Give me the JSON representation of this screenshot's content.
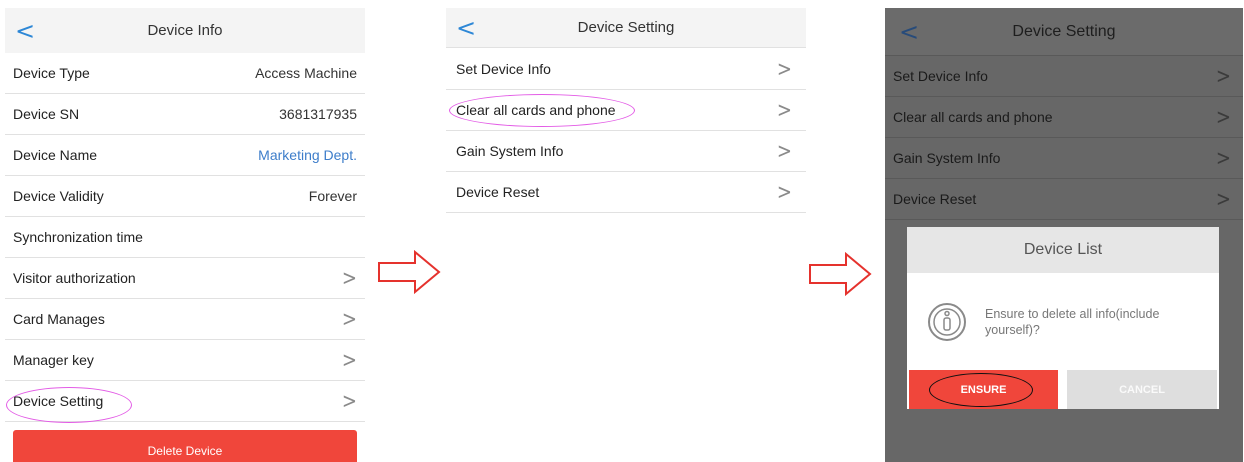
{
  "panel_device_info": {
    "title": "Device Info",
    "back_glyph": "<",
    "rows": [
      {
        "label": "Device Type",
        "value": "Access Machine"
      },
      {
        "label": "Device SN",
        "value": "3681317935"
      },
      {
        "label": "Device Name",
        "value": "Marketing Dept."
      },
      {
        "label": "Device Validity",
        "value": "Forever"
      },
      {
        "label": "Synchronization time",
        "value": ""
      },
      {
        "label": "Visitor authorization",
        "value": ">"
      },
      {
        "label": "Card Manages",
        "value": ">"
      },
      {
        "label": "Manager key",
        "value": ">"
      },
      {
        "label": "Device Setting",
        "value": ">"
      }
    ],
    "delete_button": "Delete Device"
  },
  "panel_device_setting": {
    "title": "Device Setting",
    "back_glyph": "<",
    "rows": [
      {
        "label": "Set Device Info",
        "chevron": ">"
      },
      {
        "label": "Clear all cards and phone",
        "chevron": ">"
      },
      {
        "label": "Gain System Info",
        "chevron": ">"
      },
      {
        "label": "Device Reset",
        "chevron": ">"
      }
    ]
  },
  "panel_dialog": {
    "title": "Device Setting",
    "back_glyph": "<",
    "rows": [
      {
        "label": "Set Device Info",
        "chevron": ">"
      },
      {
        "label": "Clear all cards and phone",
        "chevron": ">"
      },
      {
        "label": "Gain System Info",
        "chevron": ">"
      },
      {
        "label": "Device Reset",
        "chevron": ">"
      }
    ],
    "dialog": {
      "title": "Device List",
      "message": "Ensure to delete all info(include yourself)?",
      "ensure": "ENSURE",
      "cancel": "CANCEL"
    }
  },
  "colors": {
    "accent_blue": "#2d87d6",
    "danger_red": "#f0463b",
    "highlight_pink": "#e35ce6",
    "flow_arrow": "#e5322d"
  },
  "icons": [
    "back-chevron-icon",
    "chevron-right-icon",
    "info-icon",
    "flow-arrow-icon"
  ]
}
